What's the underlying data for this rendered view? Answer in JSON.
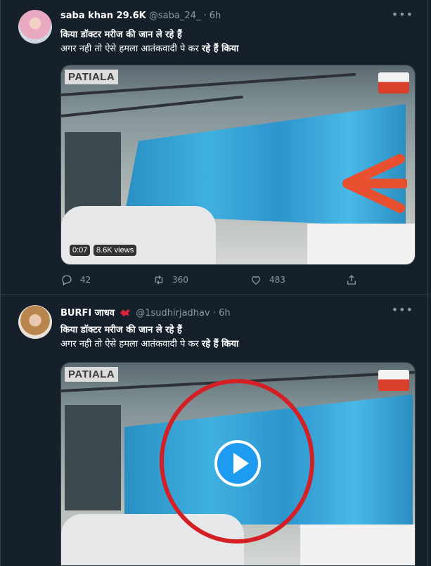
{
  "tweets": [
    {
      "name": "saba khan 29.6K",
      "handle": "@saba_24_",
      "separator": "·",
      "time": "6h",
      "line1": "किया डॉक्टर मरीज की जान ले रहे हैं",
      "line2_regular": "अगर नही तो ऐसे हमला आतंकवादी पे कर ",
      "line2_bold": "रहे हैं किया",
      "video_watermark": "PATIALA",
      "video_duration": "0:07",
      "video_views": "8.6K views",
      "replies": "42",
      "retweets": "360",
      "likes": "483"
    },
    {
      "name": "BURFI जाधव",
      "handle": "@1sudhirjadhav",
      "separator": "·",
      "time": "6h",
      "line1": "किया डॉक्टर मरीज की जान ले रहे हैं",
      "line2_regular": "अगर नही तो ऐसे हमला आतंकवादी पे कर ",
      "line2_bold": "रहे हैं किया",
      "video_watermark": "PATIALA"
    }
  ],
  "icons": {
    "more": "more-icon",
    "reply": "reply-icon",
    "retweet": "retweet-icon",
    "like": "heart-icon",
    "share": "share-icon",
    "play": "play-icon",
    "bird": "bird-icon"
  },
  "colors": {
    "background": "#15202b",
    "border": "#38444d",
    "muted": "#8899a6",
    "accent": "#1d9bf0",
    "highlight_red": "#d41f24",
    "arrow_orange": "#e8502f"
  }
}
